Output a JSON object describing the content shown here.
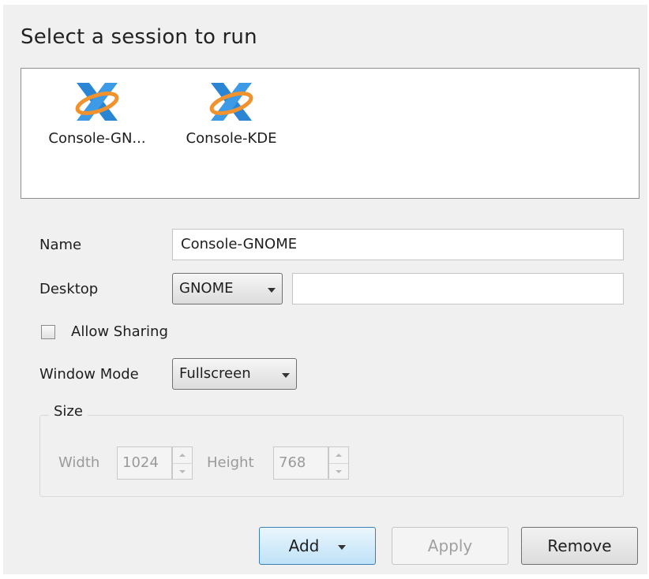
{
  "title": "Select a session to run",
  "sessions": [
    {
      "label": "Console-GN...",
      "icon": "x-session-icon"
    },
    {
      "label": "Console-KDE",
      "icon": "x-session-icon"
    }
  ],
  "form": {
    "name_label": "Name",
    "name_value": "Console-GNOME",
    "desktop_label": "Desktop",
    "desktop_value": "GNOME",
    "desktop_extra_value": "",
    "allow_sharing_label": "Allow Sharing",
    "allow_sharing_checked": false,
    "window_mode_label": "Window Mode",
    "window_mode_value": "Fullscreen",
    "size_group_label": "Size",
    "width_label": "Width",
    "width_value": "1024",
    "height_label": "Height",
    "height_value": "768"
  },
  "buttons": {
    "add": "Add",
    "apply": "Apply",
    "remove": "Remove"
  },
  "colors": {
    "icon_blue": "#2a86d4",
    "icon_orange": "#f0922e",
    "default_button": "#bfe2f7"
  }
}
